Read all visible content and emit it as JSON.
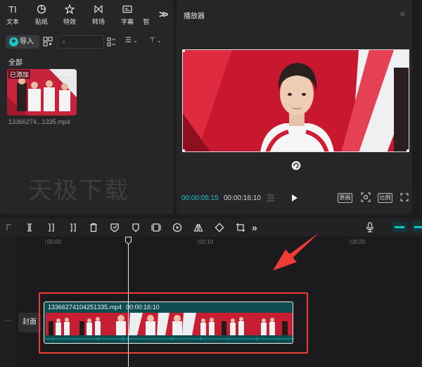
{
  "media_panel": {
    "tabs": [
      {
        "label": "文本",
        "icon": "text-icon",
        "glyph": "TI"
      },
      {
        "label": "贴纸",
        "icon": "sticker-icon",
        "glyph": ""
      },
      {
        "label": "特效",
        "icon": "effects-icon",
        "glyph": ""
      },
      {
        "label": "转场",
        "icon": "transition-icon",
        "glyph": ""
      },
      {
        "label": "字幕",
        "icon": "subtitle-icon",
        "glyph": ""
      },
      {
        "label": "智",
        "icon": "smart-icon",
        "glyph": ""
      }
    ],
    "more_tabs_glyph": ">>",
    "import_label": "导入",
    "search_placeholder": "",
    "all_label": "全部",
    "card": {
      "badge": "已添加",
      "duration": "00:17",
      "filename": "13366274...1335.mp4"
    },
    "watermark": "天极下载"
  },
  "player": {
    "title": "播放器",
    "current_time": "00:00:05:15",
    "total_time": "00:00:16:10",
    "buttons": {
      "original": "原画",
      "ratio": "比例"
    }
  },
  "timeline": {
    "ruler_labels": [
      "00:00",
      "00:10",
      "00:20"
    ],
    "cover_label": "封面",
    "track_menu": "···",
    "clip": {
      "name": "13366274104251335.mp4",
      "duration": "00:00:16:10"
    }
  },
  "colors": {
    "accent": "#19c6c6",
    "highlight": "#ef3a37",
    "clip_bg": "#0e4c50",
    "panel_bg": "#262628"
  }
}
